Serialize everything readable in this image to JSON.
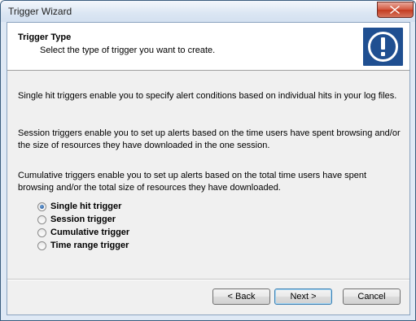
{
  "window": {
    "title": "Trigger Wizard",
    "close_icon": "close-icon"
  },
  "header": {
    "title": "Trigger Type",
    "subtitle": "Select the type of trigger you want to create.",
    "icon": "exclamation-icon",
    "icon_color": "#1f4f91"
  },
  "descriptions": [
    "Single hit triggers enable you to specify alert conditions based on individual hits in your log files.",
    "Session triggers enable you to set up alerts based on the time users have spent browsing and/or the size of resources they have downloaded in the one session.",
    "Cumulative triggers enable you to set up alerts based on the total time users have spent browsing and/or the total size of resources they have downloaded."
  ],
  "options": [
    {
      "label": "Single hit trigger",
      "selected": true
    },
    {
      "label": "Session trigger",
      "selected": false
    },
    {
      "label": "Cumulative trigger",
      "selected": false
    },
    {
      "label": "Time range trigger",
      "selected": false
    }
  ],
  "buttons": {
    "back": "< Back",
    "next": "Next >",
    "cancel": "Cancel"
  }
}
